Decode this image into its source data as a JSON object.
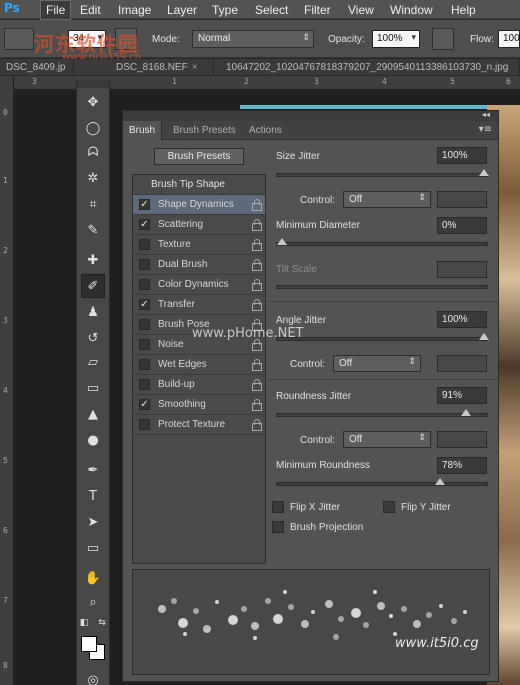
{
  "app": {
    "logo": "Ps"
  },
  "menubar": {
    "items": [
      "File",
      "Edit",
      "Image",
      "Layer",
      "Type",
      "Select",
      "Filter",
      "View",
      "Window",
      "Help"
    ]
  },
  "options": {
    "brush_size": "34",
    "mode_label": "Mode:",
    "mode_value": "Normal",
    "opacity_label": "Opacity:",
    "opacity_value": "100%",
    "flow_label": "Flow:",
    "flow_value": "100"
  },
  "tabs": [
    {
      "label": "DSC_8409.jp"
    },
    {
      "label": "DSC_8168.NEF"
    },
    {
      "label": "10647202_10204767818379207_2909540113386103730_n.jpg"
    }
  ],
  "rulers": {
    "top_ticks": [
      "3",
      "1",
      "2",
      "3",
      "4",
      "5",
      "6"
    ],
    "left_ticks": [
      "0",
      "1",
      "2",
      "3",
      "4",
      "5",
      "6",
      "7",
      "8"
    ]
  },
  "watermarks": {
    "top_cn": "河东软件园",
    "top_url": "www.pc0359.cn",
    "mid_url": "www.pHome.NET",
    "bottom_url": "www.it5i0.cg"
  },
  "panel": {
    "tabs": [
      "Brush",
      "Brush Presets",
      "Actions"
    ],
    "presets_button": "Brush Presets",
    "list_header": "Brush Tip Shape",
    "list": [
      {
        "label": "Shape Dynamics",
        "checked": true,
        "selected": true
      },
      {
        "label": "Scattering",
        "checked": true,
        "selected": false
      },
      {
        "label": "Texture",
        "checked": false,
        "selected": false
      },
      {
        "label": "Dual Brush",
        "checked": false,
        "selected": false
      },
      {
        "label": "Color Dynamics",
        "checked": false,
        "selected": false
      },
      {
        "label": "Transfer",
        "checked": true,
        "selected": false
      },
      {
        "label": "Brush Pose",
        "checked": false,
        "selected": false
      },
      {
        "label": "Noise",
        "checked": false,
        "selected": false
      },
      {
        "label": "Wet Edges",
        "checked": false,
        "selected": false
      },
      {
        "label": "Build-up",
        "checked": false,
        "selected": false
      },
      {
        "label": "Smoothing",
        "checked": true,
        "selected": false
      },
      {
        "label": "Protect Texture",
        "checked": false,
        "selected": false
      }
    ],
    "size_jitter": {
      "label": "Size Jitter",
      "value": "100%",
      "level": 1.0
    },
    "control1": {
      "label": "Control:",
      "value": "Off"
    },
    "min_diameter": {
      "label": "Minimum Diameter",
      "value": "0%",
      "level": 0.0
    },
    "tilt_scale": {
      "label": "Tilt Scale"
    },
    "angle_jitter": {
      "label": "Angle Jitter",
      "value": "100%",
      "level": 1.0
    },
    "control2": {
      "label": "Control:",
      "value": "Off"
    },
    "roundness_jitter": {
      "label": "Roundness Jitter",
      "value": "91%",
      "level": 0.91
    },
    "control3": {
      "label": "Control:",
      "value": "Off"
    },
    "min_roundness": {
      "label": "Minimum Roundness",
      "value": "78%",
      "level": 0.78
    },
    "flip_x": "Flip X Jitter",
    "flip_y": "Flip Y Jitter",
    "brush_projection": "Brush Projection"
  },
  "colors": {
    "foreground": "#ffffff",
    "background": "#ffffff",
    "selection": "#5e6a7a"
  }
}
